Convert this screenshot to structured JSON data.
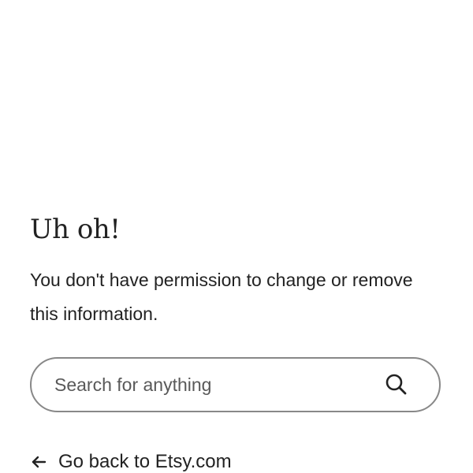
{
  "error": {
    "title": "Uh oh!",
    "message": "You don't have permission to change or remove this information."
  },
  "search": {
    "placeholder": "Search for anything",
    "value": "",
    "button_icon": "search-icon"
  },
  "back_link": {
    "label": "Go back to Etsy.com",
    "icon": "arrow-left-icon"
  },
  "colors": {
    "text": "#222222",
    "placeholder": "#595959",
    "border": "#888888",
    "background": "#ffffff"
  }
}
